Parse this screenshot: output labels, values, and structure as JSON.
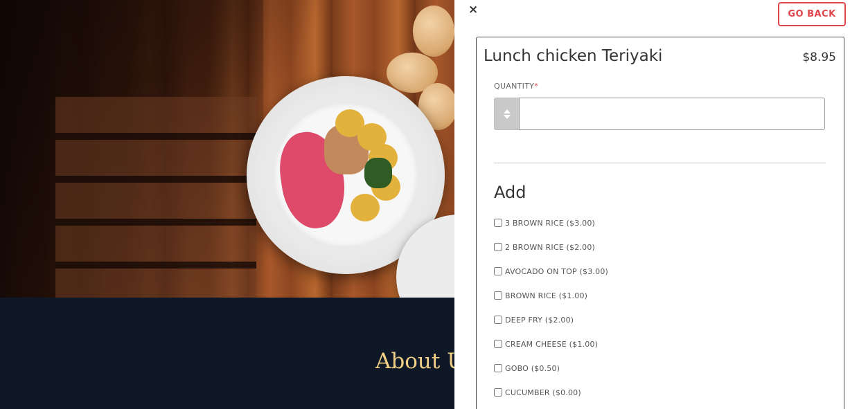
{
  "background": {
    "about_title": "About Us"
  },
  "panel": {
    "close_icon": "×",
    "go_back_label": "GO BACK",
    "item": {
      "name": "Lunch chicken Teriyaki",
      "price": "$8.95"
    },
    "quantity": {
      "label": "QUANTITY",
      "required_mark": "*",
      "value": ""
    },
    "add_section": {
      "title": "Add",
      "options": [
        "3 BROWN RICE ($3.00)",
        "2 BROWN RICE ($2.00)",
        "AVOCADO ON TOP ($3.00)",
        "BROWN RICE ($1.00)",
        "DEEP FRY ($2.00)",
        "CREAM CHEESE ($1.00)",
        "GOBO ($0.50)",
        "CUCUMBER ($0.00)"
      ]
    }
  },
  "colors": {
    "accent_red": "#e0474c",
    "about_title_gold": "#f2cf86",
    "footer_bg": "#0f1826"
  }
}
